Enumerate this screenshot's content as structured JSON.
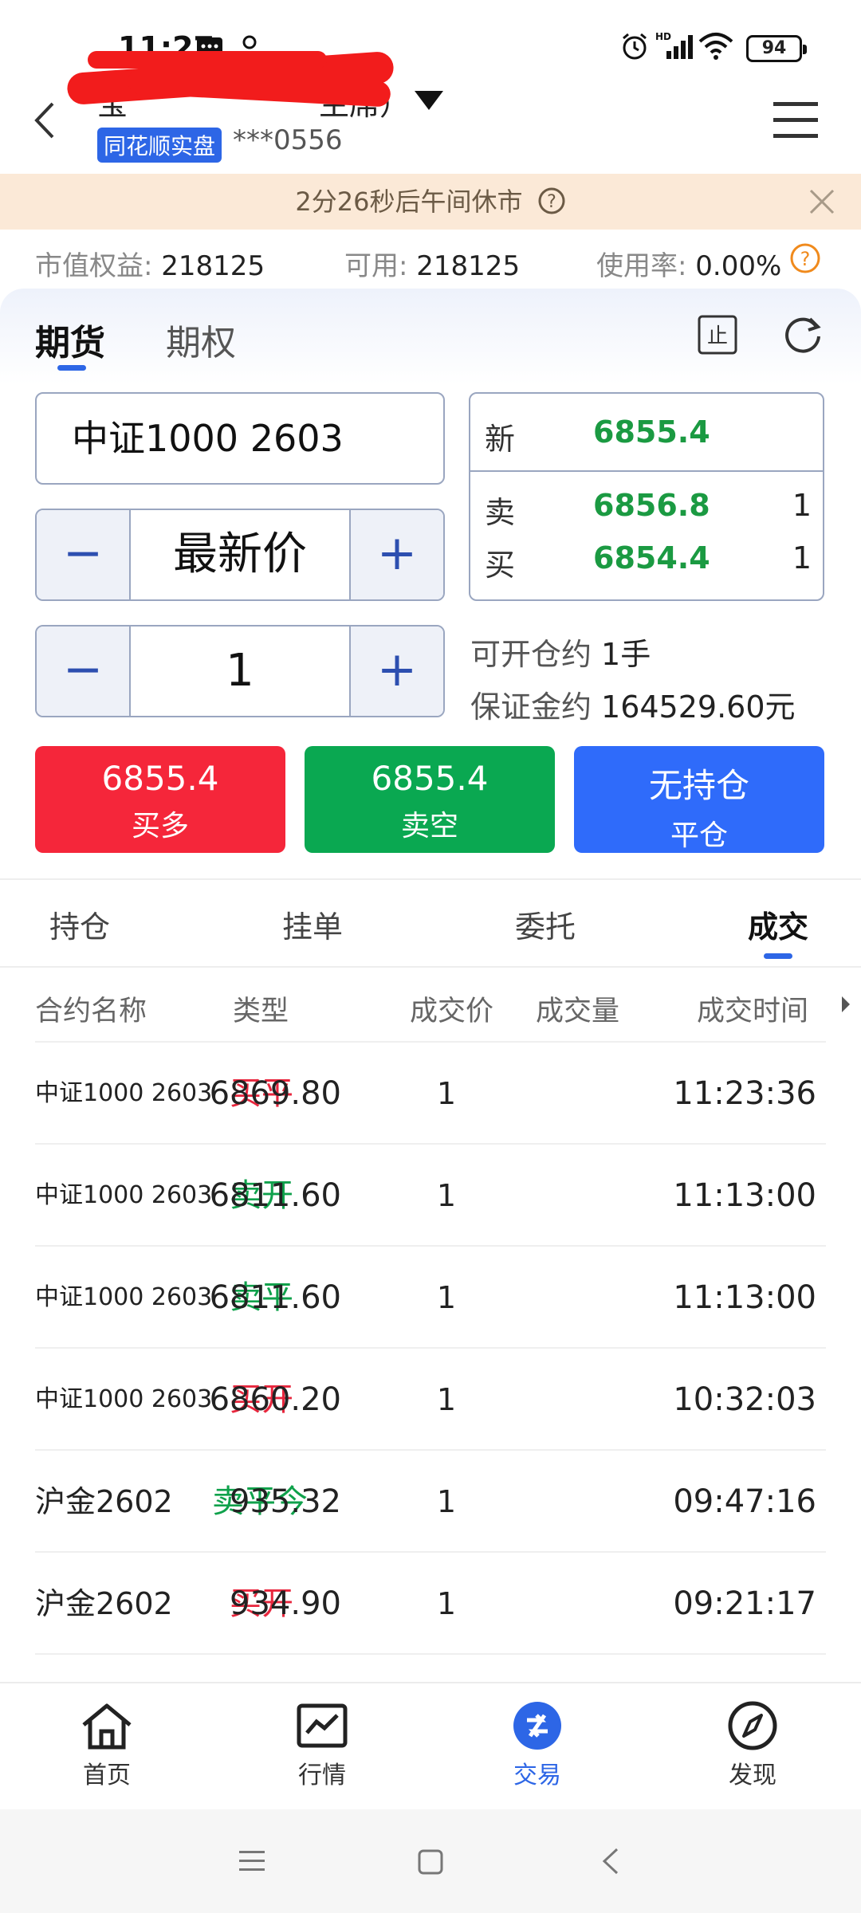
{
  "status_bar": {
    "time": "11:27",
    "battery": "94"
  },
  "header": {
    "account_title": "宝",
    "account_title_suffix": "主席）",
    "broker_badge": "同花顺实盘",
    "account_no": "***0556"
  },
  "notice": {
    "text": "2分26秒后午间休市"
  },
  "stats": {
    "equity_label": "市值权益:",
    "equity_value": "218125",
    "available_label": "可用:",
    "available_value": "218125",
    "usage_label": "使用率:",
    "usage_value": "0.00%"
  },
  "product_tabs": {
    "futures": "期货",
    "options": "期权"
  },
  "order_form": {
    "contract": "中证1000 2603",
    "price_type": "最新价",
    "quantity": "1",
    "minus": "−",
    "plus": "+"
  },
  "quote": {
    "last_label": "新",
    "last_price": "6855.4",
    "ask_label": "卖",
    "ask_price": "6856.8",
    "ask_qty": "1",
    "bid_label": "买",
    "bid_price": "6854.4",
    "bid_qty": "1"
  },
  "info": {
    "openable_label": "可开仓约",
    "openable_value": "1手",
    "margin_label": "保证金约",
    "margin_value": "164529.60元"
  },
  "actions": {
    "buy_long_price": "6855.4",
    "buy_long_label": "买多",
    "sell_short_price": "6855.4",
    "sell_short_label": "卖空",
    "close_status": "无持仓",
    "close_label": "平仓"
  },
  "order_tabs": {
    "positions": "持仓",
    "pending": "挂单",
    "orders": "委托",
    "trades": "成交"
  },
  "table": {
    "headers": {
      "name": "合约名称",
      "type": "类型",
      "price": "成交价",
      "qty": "成交量",
      "time": "成交时间"
    },
    "rows": [
      {
        "name": "中证1000 2603",
        "type": "买平",
        "price": "6869.80",
        "qty": "1",
        "time": "11:23:36"
      },
      {
        "name": "中证1000 2603",
        "type": "卖开",
        "price": "6811.60",
        "qty": "1",
        "time": "11:13:00"
      },
      {
        "name": "中证1000 2603",
        "type": "卖平",
        "price": "6811.60",
        "qty": "1",
        "time": "11:13:00"
      },
      {
        "name": "中证1000 2603",
        "type": "买开",
        "price": "6860.20",
        "qty": "1",
        "time": "10:32:03"
      },
      {
        "name": "沪金2602",
        "type": "卖平今",
        "price": "935.32",
        "qty": "1",
        "time": "09:47:16"
      },
      {
        "name": "沪金2602",
        "type": "买开",
        "price": "934.90",
        "qty": "1",
        "time": "09:21:17"
      }
    ]
  },
  "bottom_nav": {
    "home": "首页",
    "market": "行情",
    "trade": "交易",
    "discover": "发现"
  },
  "colors": {
    "accent": "#2d66e6",
    "buy": "#f5263a",
    "sell": "#0aa851",
    "close": "#2f6bfa",
    "up_text": "#e8263d",
    "down_text": "#0fa14b"
  }
}
